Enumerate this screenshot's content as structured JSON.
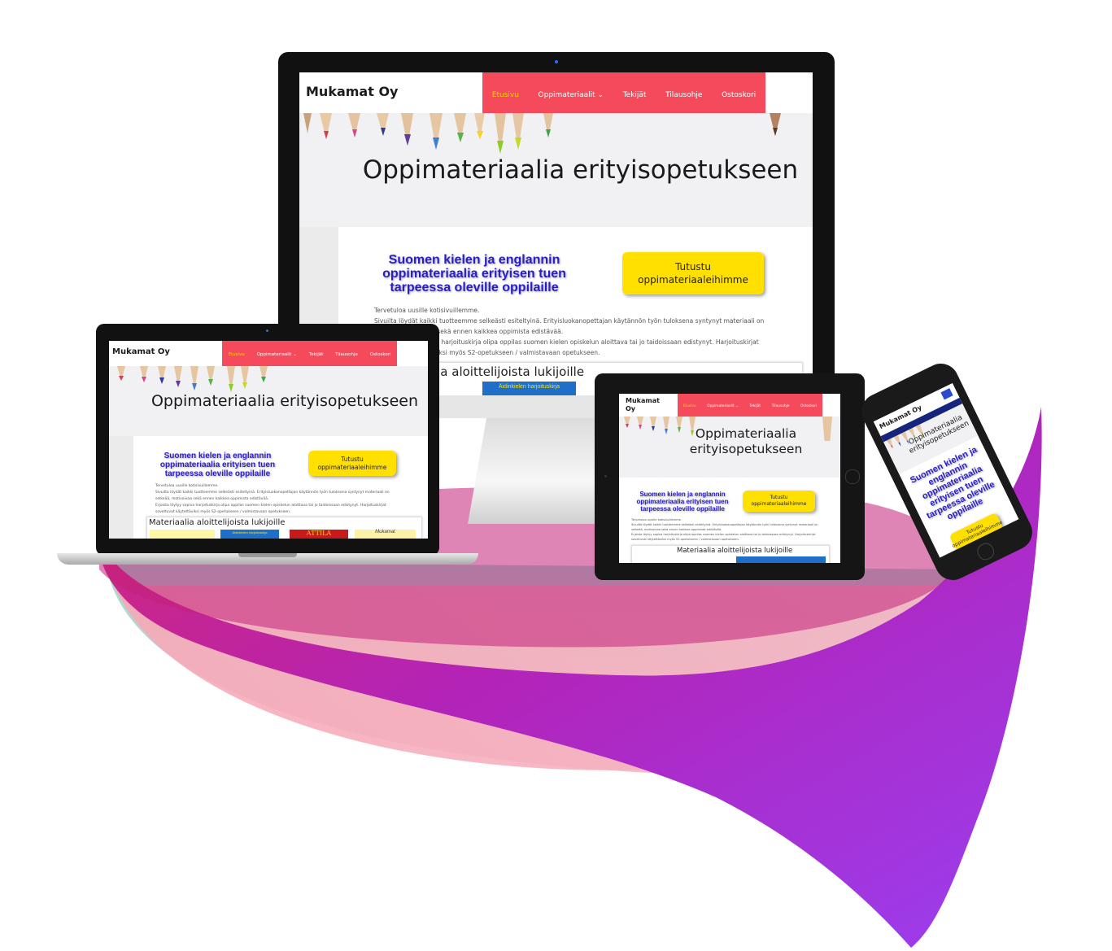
{
  "site": {
    "logo": "Mukamat Oy",
    "logo_tablet_line1": "Mukamat",
    "logo_tablet_line2": "Oy",
    "nav": [
      "Etusivu",
      "Oppimateriaalit",
      "Tekijät",
      "Tilausohje",
      "Ostoskori"
    ],
    "nav_chevron": "chevron-down-icon",
    "hero_title": "Oppimateriaalia erityisopetukseen",
    "hero_title_line1": "Oppimateriaalia",
    "hero_title_line2": "erityisopetukseen",
    "intro_heading": "Suomen kielen ja englannin oppimateriaalia erityisen tuen tarpeessa oleville oppilaille",
    "cta_label": "Tutustu oppimateriaaleihimme",
    "cta_line1": "Tutustu",
    "cta_line2": "oppimateriaaleihimme",
    "intro_text": [
      "Tervetuloa uusille kotisivuillemme.",
      "Sivuilta löydät kaikki tuotteemme selkeästi esiteltyinä. Erityisluokanopettajan käytännön työn tuloksena syntynyt materiaali on selkeää, motivoivaa sekä ennen kaikkea oppimista edistävää.",
      "Erjoista löytyy sopiva harjoituskirja olipa oppilas suomen kielen opiskelun aloittava tai jo taidoissaan edistynyt. Harjoituskirjat soveltuvat käytettäviksi myös S2-opetukseen / valmistavaan opetukseen."
    ],
    "materials_title": "Materiaalia aloittelijoista lukijoille",
    "book_label": "Äidinkielen harjoituskirja",
    "book_attila": "ATTILA",
    "book_mukamat": "Mukamat",
    "brand_color": "#f44a5c",
    "cta_color": "#ffe000",
    "heading_color": "#2a1ec8",
    "swoosh_colors": [
      "#c01e7a",
      "#9b2bd8",
      "#f6a3b7",
      "#7fd6c4"
    ]
  },
  "devices": [
    "desktop-monitor",
    "laptop",
    "tablet",
    "phone"
  ]
}
